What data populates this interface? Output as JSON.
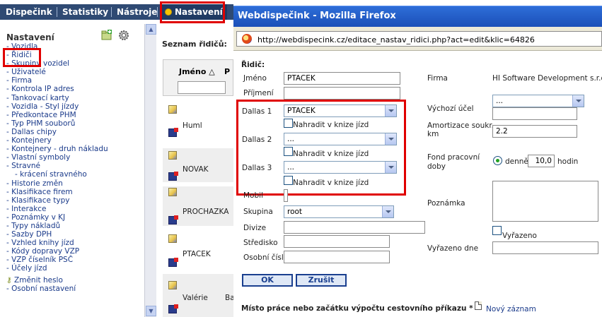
{
  "topnav": {
    "items": [
      "Dispečink",
      "Statistiky",
      "Nástroje",
      "Nastavení"
    ]
  },
  "sidebar": {
    "title": "Nastavení",
    "items": [
      "- Vozidla",
      "- Řidiči",
      "- Skupiny vozidel",
      "- Uživatelé",
      "- Firma",
      "- Kontrola IP adres",
      "- Tankovací karty",
      "- Vozidla - Styl jízdy",
      "- Předkontace PHM",
      "- Typ PHM souborů",
      "- Dallas chipy",
      "- Kontejnery",
      "- Kontejnery - druh nákladu",
      "- Vlastní symboly",
      "- Stravné",
      "- krácení stravného",
      "- Historie změn",
      "- Klasifikace firem",
      "- Klasifikace typy",
      "- Interakce",
      "- Poznámky v KJ",
      "- Typy nákladů",
      "- Sazby DPH",
      "- Vzhled knihy jízd",
      "- Kódy dopravy VZP",
      "- VZP číselník PSČ",
      "- Účely jízd",
      "Změnit heslo",
      "- Osobní nastavení"
    ]
  },
  "midpanel": {
    "title": "Seznam řidičů:",
    "col_header": "Jméno",
    "col_header2": "P",
    "rows": [
      "Huml",
      "NOVAK",
      "PROCHAZKA",
      "PTACEK",
      "Valérie"
    ],
    "extra": "Ba"
  },
  "window": {
    "title": "Webdispečink - Mozilla Firefox",
    "url": "http://webdispecink.cz/editace_nastav_ridici.php?act=edit&klic=64826"
  },
  "form": {
    "section": "Řidič:",
    "jmeno_label": "Jméno",
    "jmeno_value": "PTACEK",
    "prijmeni_label": "Příjmení",
    "dallas1_label": "Dallas 1",
    "dallas1_value": "PTACEK",
    "dallas2_label": "Dallas 2",
    "dallas2_value": "...",
    "dallas3_label": "Dallas 3",
    "dallas3_value": "...",
    "nahradit_label": "Nahradit v knize jízd",
    "mobil_label": "Mobil",
    "skupina_label": "Skupina",
    "skupina_value": "root",
    "divize_label": "Divize",
    "stredisko_label": "Středisko",
    "osobni_label": "Osobní číslo",
    "ok": "OK",
    "zrusit": "Zrušit",
    "firma_label": "Firma",
    "firma_value": "HI Software Development s.r.o.",
    "vychozi_label": "Výchozí účel",
    "vychozi_value": "...",
    "amort_label1": "Amortizace soukr.",
    "amort_label2": "km",
    "amort_value": "2.2",
    "fond_label1": "Fond pracovní",
    "fond_label2": "doby",
    "fond_radio": "denně",
    "fond_value": "10,0",
    "fond_unit": "hodin",
    "poznamka_label": "Poznámka",
    "vyrazeno_label": "Vyřazeno",
    "vyrazeno_dne_label": "Vyřazeno dne",
    "misto_label": "Místo práce nebo začátku výpočtu cestovního příkazu *",
    "novy_zaznam": "Nový záznam"
  }
}
